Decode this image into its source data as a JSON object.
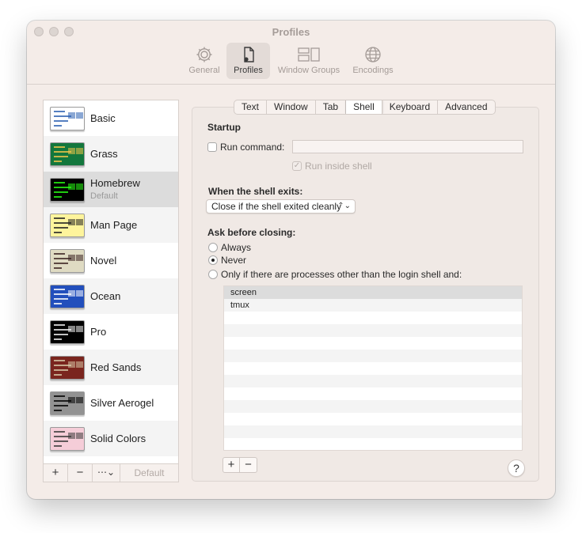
{
  "window": {
    "title": "Profiles"
  },
  "toolbar": {
    "items": [
      {
        "label": "General",
        "icon": "gear-icon"
      },
      {
        "label": "Profiles",
        "icon": "profile-document-icon",
        "selected": true
      },
      {
        "label": "Window Groups",
        "icon": "window-groups-icon"
      },
      {
        "label": "Encodings",
        "icon": "globe-icon"
      }
    ]
  },
  "sidebar": {
    "profiles": [
      {
        "name": "Basic",
        "bg": "#ffffff",
        "fg": "#2a5fb0"
      },
      {
        "name": "Grass",
        "bg": "#13773d",
        "fg": "#f3c64b"
      },
      {
        "name": "Homebrew",
        "subtitle": "Default",
        "bg": "#000000",
        "fg": "#28fe14",
        "selected": true
      },
      {
        "name": "Man Page",
        "bg": "#fef49c",
        "fg": "#222222"
      },
      {
        "name": "Novel",
        "bg": "#dfdbc3",
        "fg": "#3b2322"
      },
      {
        "name": "Ocean",
        "bg": "#224fbc",
        "fg": "#ffffff"
      },
      {
        "name": "Pro",
        "bg": "#000000",
        "fg": "#f2f2f2"
      },
      {
        "name": "Red Sands",
        "bg": "#7a251e",
        "fg": "#d7c9a7"
      },
      {
        "name": "Silver Aerogel",
        "bg": "#929292",
        "fg": "#000000"
      },
      {
        "name": "Solid Colors",
        "bg": "#f5cdd8",
        "fg": "#3a3a3a"
      }
    ],
    "buttons": {
      "add": "+",
      "remove": "−",
      "more": "⋯⌄",
      "default": "Default"
    }
  },
  "tabs": [
    "Text",
    "Window",
    "Tab",
    "Shell",
    "Keyboard",
    "Advanced"
  ],
  "selected_tab": "Shell",
  "shell": {
    "startup_heading": "Startup",
    "run_command_label": "Run command:",
    "run_command_checked": false,
    "run_command_value": "",
    "run_inside_shell_label": "Run inside shell",
    "run_inside_shell_checked": true,
    "when_exits_heading": "When the shell exits:",
    "when_exits_value": "Close if the shell exited cleanly",
    "ask_heading": "Ask before closing:",
    "ask_options": [
      {
        "label": "Always",
        "selected": false
      },
      {
        "label": "Never",
        "selected": true
      },
      {
        "label": "Only if there are processes other than the login shell and:",
        "selected": false
      }
    ],
    "processes": [
      "screen",
      "tmux"
    ],
    "table_add": "+",
    "table_remove": "−",
    "help": "?"
  },
  "colors": {
    "window_bg": "#f4ece8",
    "selection": "#dcdcdc"
  }
}
